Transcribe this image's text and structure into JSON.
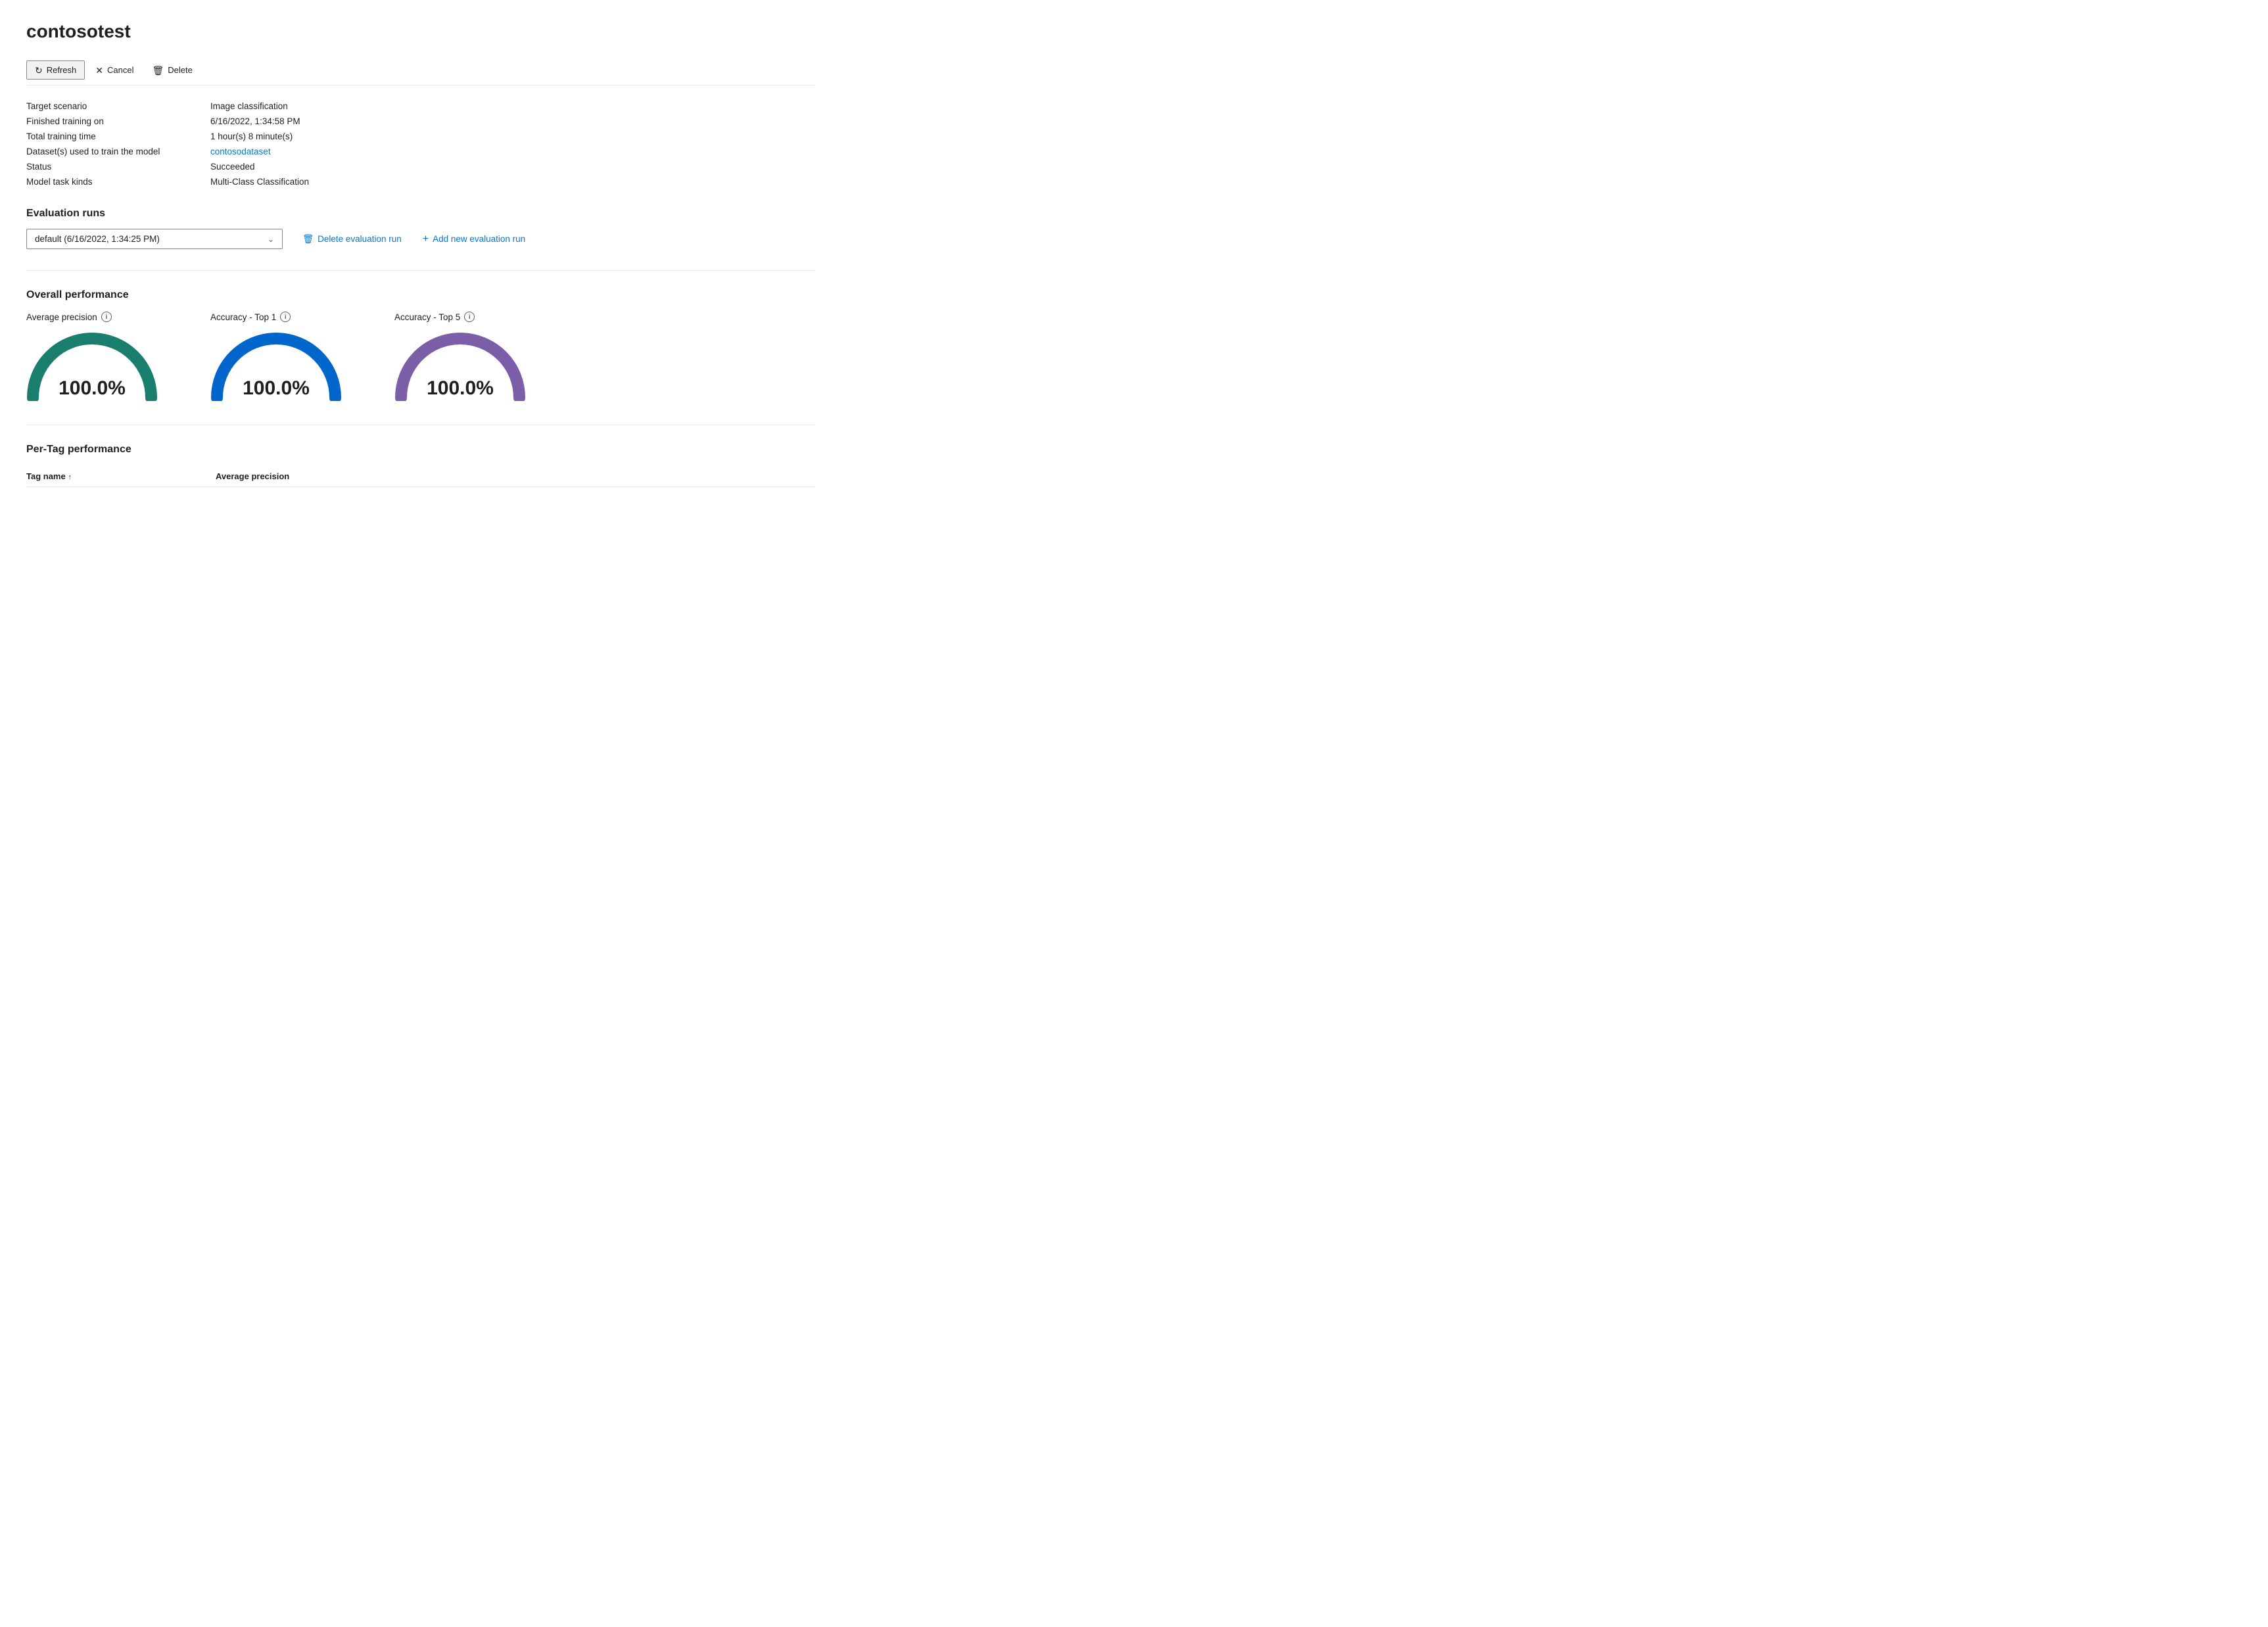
{
  "page": {
    "title": "contosotest"
  },
  "toolbar": {
    "refresh_label": "Refresh",
    "cancel_label": "Cancel",
    "delete_label": "Delete",
    "refresh_icon": "↻",
    "cancel_icon": "✕",
    "delete_icon": "🗑"
  },
  "info": {
    "fields": [
      {
        "label": "Target scenario",
        "value": "Image classification",
        "is_link": false
      },
      {
        "label": "Finished training on",
        "value": "6/16/2022, 1:34:58 PM",
        "is_link": false
      },
      {
        "label": "Total training time",
        "value": "1 hour(s) 8 minute(s)",
        "is_link": false
      },
      {
        "label": "Dataset(s) used to train the model",
        "value": "contosodataset",
        "is_link": true
      },
      {
        "label": "Status",
        "value": "Succeeded",
        "is_link": false
      },
      {
        "label": "Model task kinds",
        "value": "Multi-Class Classification",
        "is_link": false
      }
    ]
  },
  "evaluation_runs": {
    "section_title": "Evaluation runs",
    "dropdown_value": "default (6/16/2022, 1:34:25 PM)",
    "delete_btn_label": "Delete evaluation run",
    "add_btn_label": "Add new evaluation run"
  },
  "overall_performance": {
    "section_title": "Overall performance",
    "metrics": [
      {
        "label": "Average precision",
        "value": "100.0%",
        "color": "#1a7e6e"
      },
      {
        "label": "Accuracy - Top 1",
        "value": "100.0%",
        "color": "#0066cc"
      },
      {
        "label": "Accuracy - Top 5",
        "value": "100.0%",
        "color": "#7b5ea7"
      }
    ]
  },
  "per_tag": {
    "section_title": "Per-Tag performance",
    "columns": [
      {
        "label": "Tag name",
        "sortable": true,
        "sort_dir": "asc"
      },
      {
        "label": "Average precision",
        "sortable": false
      }
    ]
  },
  "icons": {
    "info": "i",
    "chevron_down": "⌄",
    "trash": "🗑",
    "plus": "+"
  }
}
